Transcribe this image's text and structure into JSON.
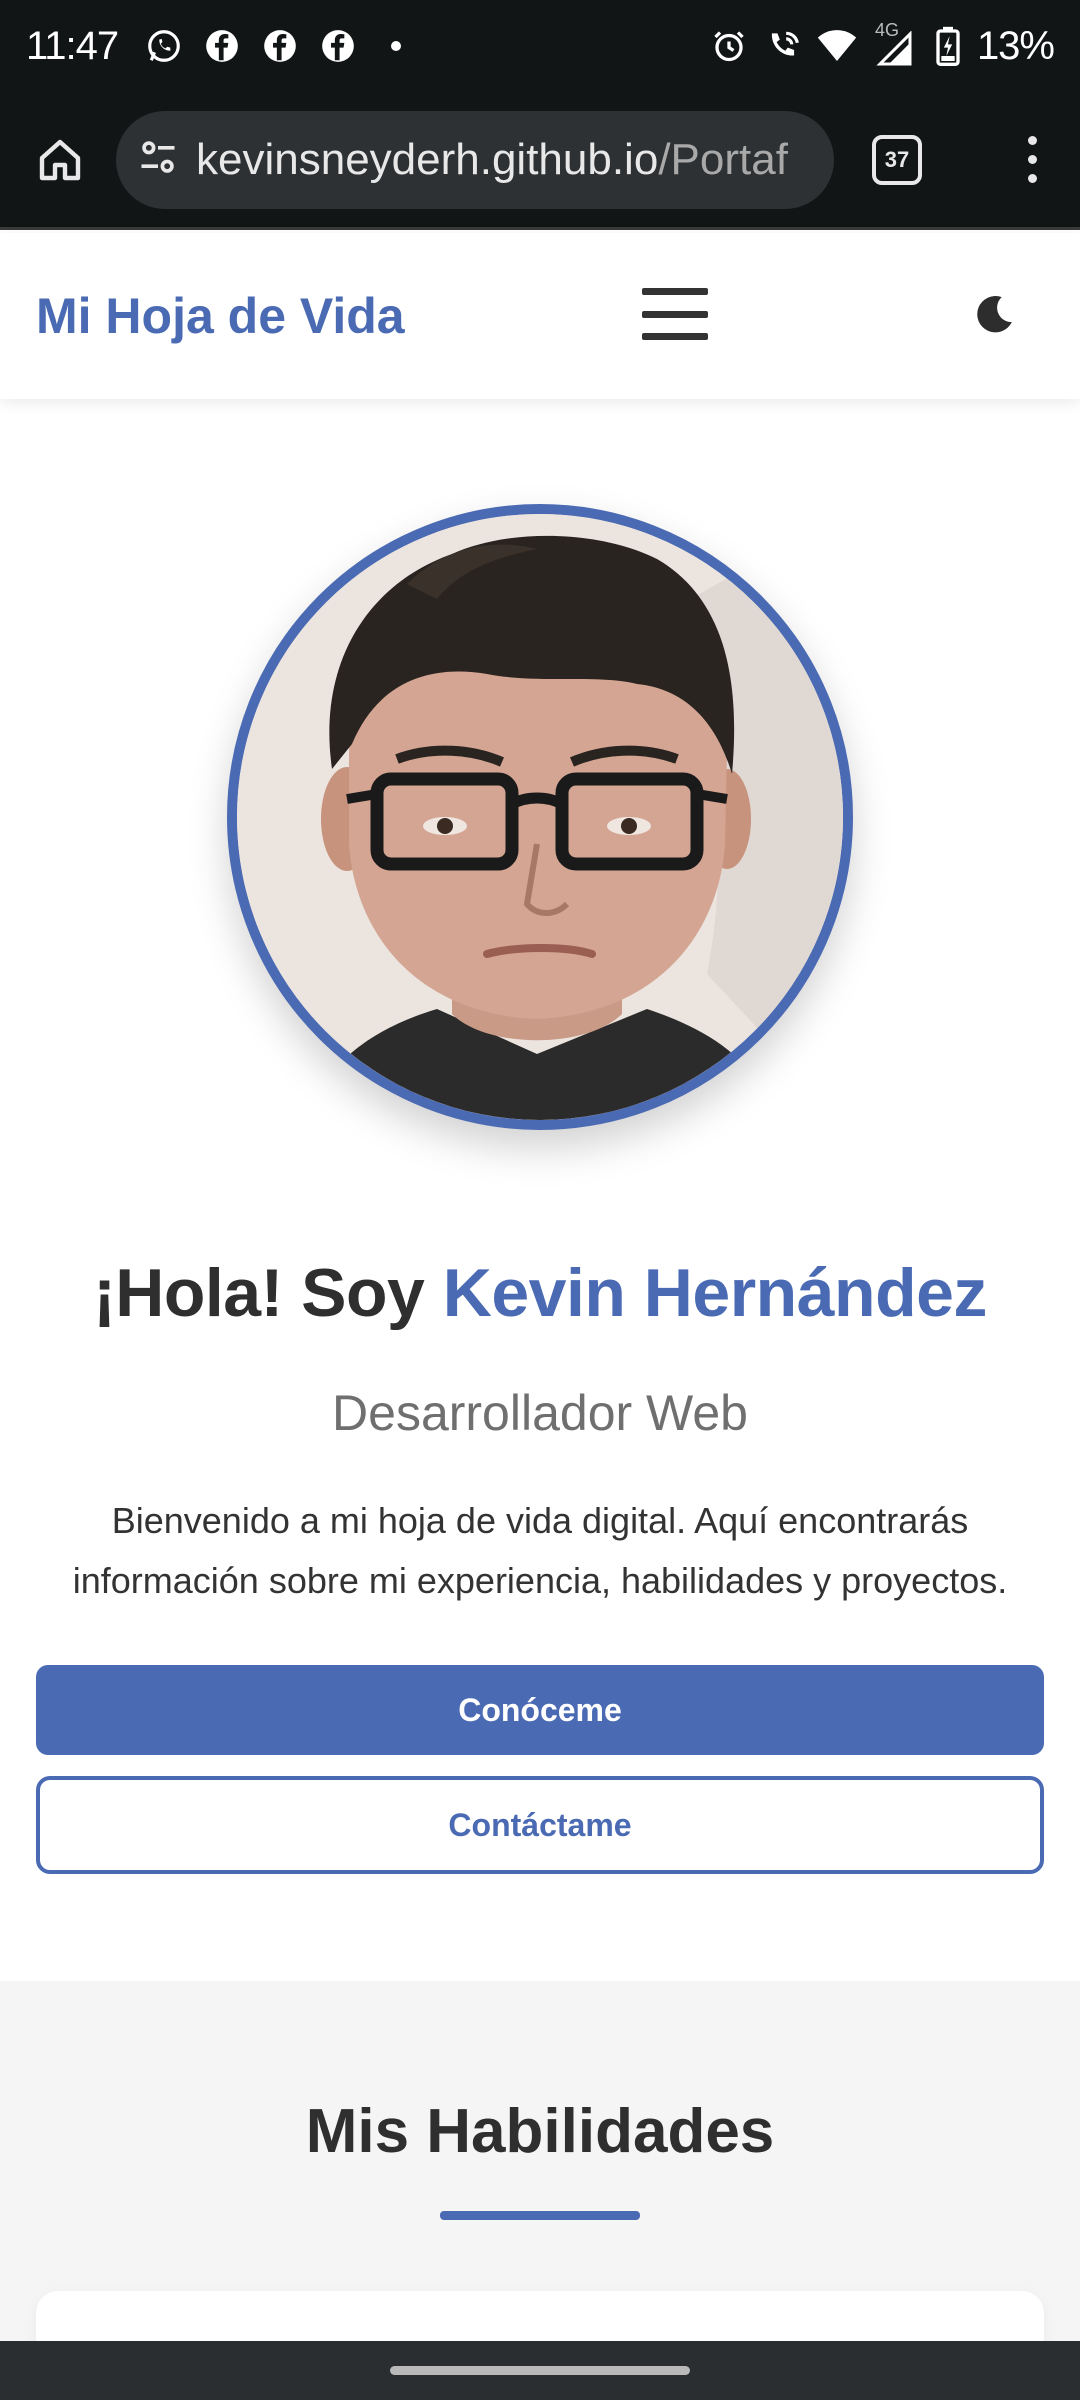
{
  "status_bar": {
    "time": "11:47",
    "left_icons": [
      "whatsapp-icon",
      "facebook-icon",
      "facebook-icon",
      "facebook-icon",
      "dot-icon"
    ],
    "right_icons": [
      "alarm-icon",
      "wifi-calling-icon",
      "wifi-icon",
      "signal-4g-icon",
      "battery-charging-icon"
    ],
    "network_label": "4G",
    "battery": "13%"
  },
  "browser": {
    "url_main": "kevinsneyderh.github.io",
    "url_path": "/Portaf",
    "tab_count": "37"
  },
  "navbar": {
    "brand": "Mi Hoja de Vida"
  },
  "hero": {
    "greeting": "¡Hola! Soy ",
    "name": "Kevin Hernández",
    "subtitle": "Desarrollador Web",
    "description": "Bienvenido a mi hoja de vida digital. Aquí encontrarás información sobre mi experiencia, habilidades y proyectos.",
    "primary_button": "Conóceme",
    "secondary_button": "Contáctame"
  },
  "skills": {
    "title": "Mis Habilidades"
  },
  "colors": {
    "accent": "#4a6ab3",
    "text": "#333333",
    "muted": "#6f6f6f",
    "section_bg": "#f5f5f5",
    "chrome_bg": "#111516"
  }
}
